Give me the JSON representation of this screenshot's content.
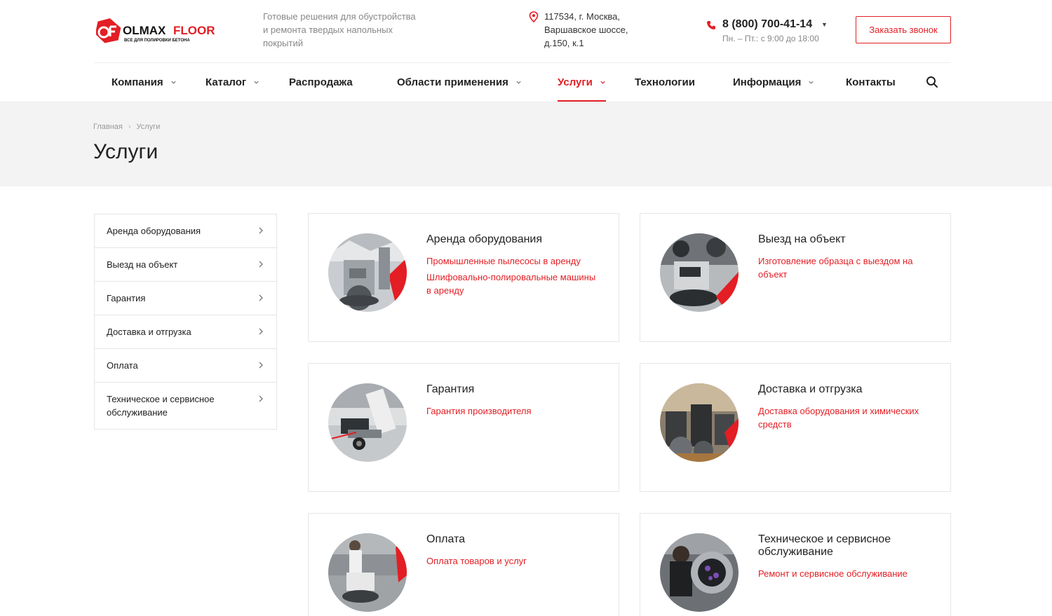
{
  "header": {
    "logo_text": "OLMAX FLOOR",
    "logo_tagline": "ВСЕ ДЛЯ ПОЛИРОВКИ БЕТОНА",
    "tagline": "Готовые решения для обустройства и ремонта твердых напольных покрытий",
    "address": "117534, г. Москва, Варшавское шоссе, д.150, к.1",
    "phone": "8 (800) 700-41-14",
    "hours": "Пн. – Пт.: с 9:00 до 18:00",
    "callback_label": "Заказать звонок",
    "accent": "#e31e24"
  },
  "nav": {
    "items": [
      {
        "label": "Компания",
        "has_dropdown": true,
        "active": false
      },
      {
        "label": "Каталог",
        "has_dropdown": true,
        "active": false
      },
      {
        "label": "Распродажа",
        "has_dropdown": false,
        "active": false
      },
      {
        "label": "Области применения",
        "has_dropdown": true,
        "active": false
      },
      {
        "label": "Услуги",
        "has_dropdown": true,
        "active": true
      },
      {
        "label": "Технологии",
        "has_dropdown": false,
        "active": false
      },
      {
        "label": "Информация",
        "has_dropdown": true,
        "active": false
      },
      {
        "label": "Контакты",
        "has_dropdown": false,
        "active": false
      }
    ]
  },
  "breadcrumb": {
    "home": "Главная",
    "current": "Услуги"
  },
  "page_title": "Услуги",
  "sidebar": {
    "items": [
      {
        "label": "Аренда оборудования"
      },
      {
        "label": "Выезд на объект"
      },
      {
        "label": "Гарантия"
      },
      {
        "label": "Доставка и отгрузка"
      },
      {
        "label": "Оплата"
      },
      {
        "label": "Техническое и сервисное обслуживание"
      }
    ]
  },
  "cards": [
    {
      "title": "Аренда оборудования",
      "links": [
        "Промышленные пылесосы в аренду",
        "Шлифовально-полировальные машины в аренду"
      ],
      "thumb_icon": "floor-grinder-photo"
    },
    {
      "title": "Выезд на объект",
      "links": [
        "Изготовление образца с выездом на объект"
      ],
      "thumb_icon": "grinder-onsite-photo"
    },
    {
      "title": "Гарантия",
      "links": [
        "Гарантия производителя"
      ],
      "thumb_icon": "machine-cart-photo"
    },
    {
      "title": "Доставка и отгрузка",
      "links": [
        "Доставка оборудования и химических средств"
      ],
      "thumb_icon": "warehouse-photo"
    },
    {
      "title": "Оплата",
      "links": [
        "Оплата товаров и услуг"
      ],
      "thumb_icon": "floor-polisher-photo"
    },
    {
      "title": "Техническое и сервисное обслуживание",
      "links": [
        "Ремонт и сервисное обслуживание"
      ],
      "thumb_icon": "service-technician-photo"
    }
  ]
}
